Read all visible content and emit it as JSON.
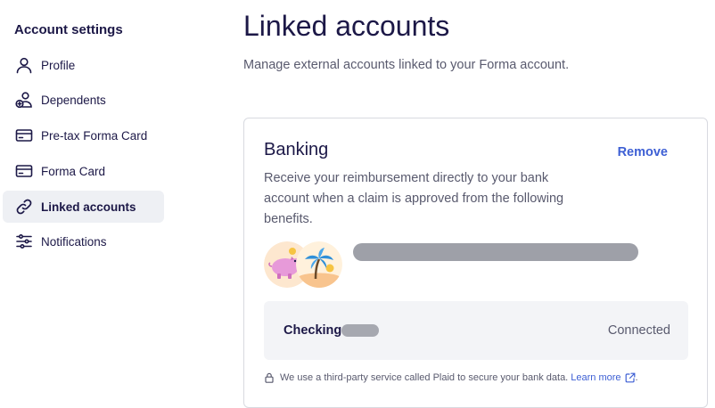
{
  "sidebar": {
    "heading": "Account settings",
    "items": [
      {
        "label": "Profile",
        "icon": "user-icon"
      },
      {
        "label": "Dependents",
        "icon": "user-add-icon"
      },
      {
        "label": "Pre-tax Forma Card",
        "icon": "credit-card-icon"
      },
      {
        "label": "Forma Card",
        "icon": "credit-card-icon"
      },
      {
        "label": "Linked accounts",
        "icon": "link-icon",
        "active": true
      },
      {
        "label": "Notifications",
        "icon": "sliders-icon"
      }
    ]
  },
  "main": {
    "title": "Linked accounts",
    "subtitle": "Manage external accounts linked to your Forma account.",
    "card": {
      "title": "Banking",
      "remove_label": "Remove",
      "description": "Receive your reimbursement directly to your bank account when a claim is approved from the following benefits.",
      "benefit_icons": [
        "piggy-bank-icon",
        "palm-tree-icon"
      ],
      "account": {
        "name": "Checking",
        "status": "Connected"
      },
      "note": "We use a third-party service called Plaid to secure your bank data.",
      "learn_more": "Learn more",
      "note_end": "."
    }
  },
  "colors": {
    "text_primary": "#1c1847",
    "text_secondary": "#595a6e",
    "accent": "#3d5fd4",
    "active_bg": "#eef0f4"
  }
}
